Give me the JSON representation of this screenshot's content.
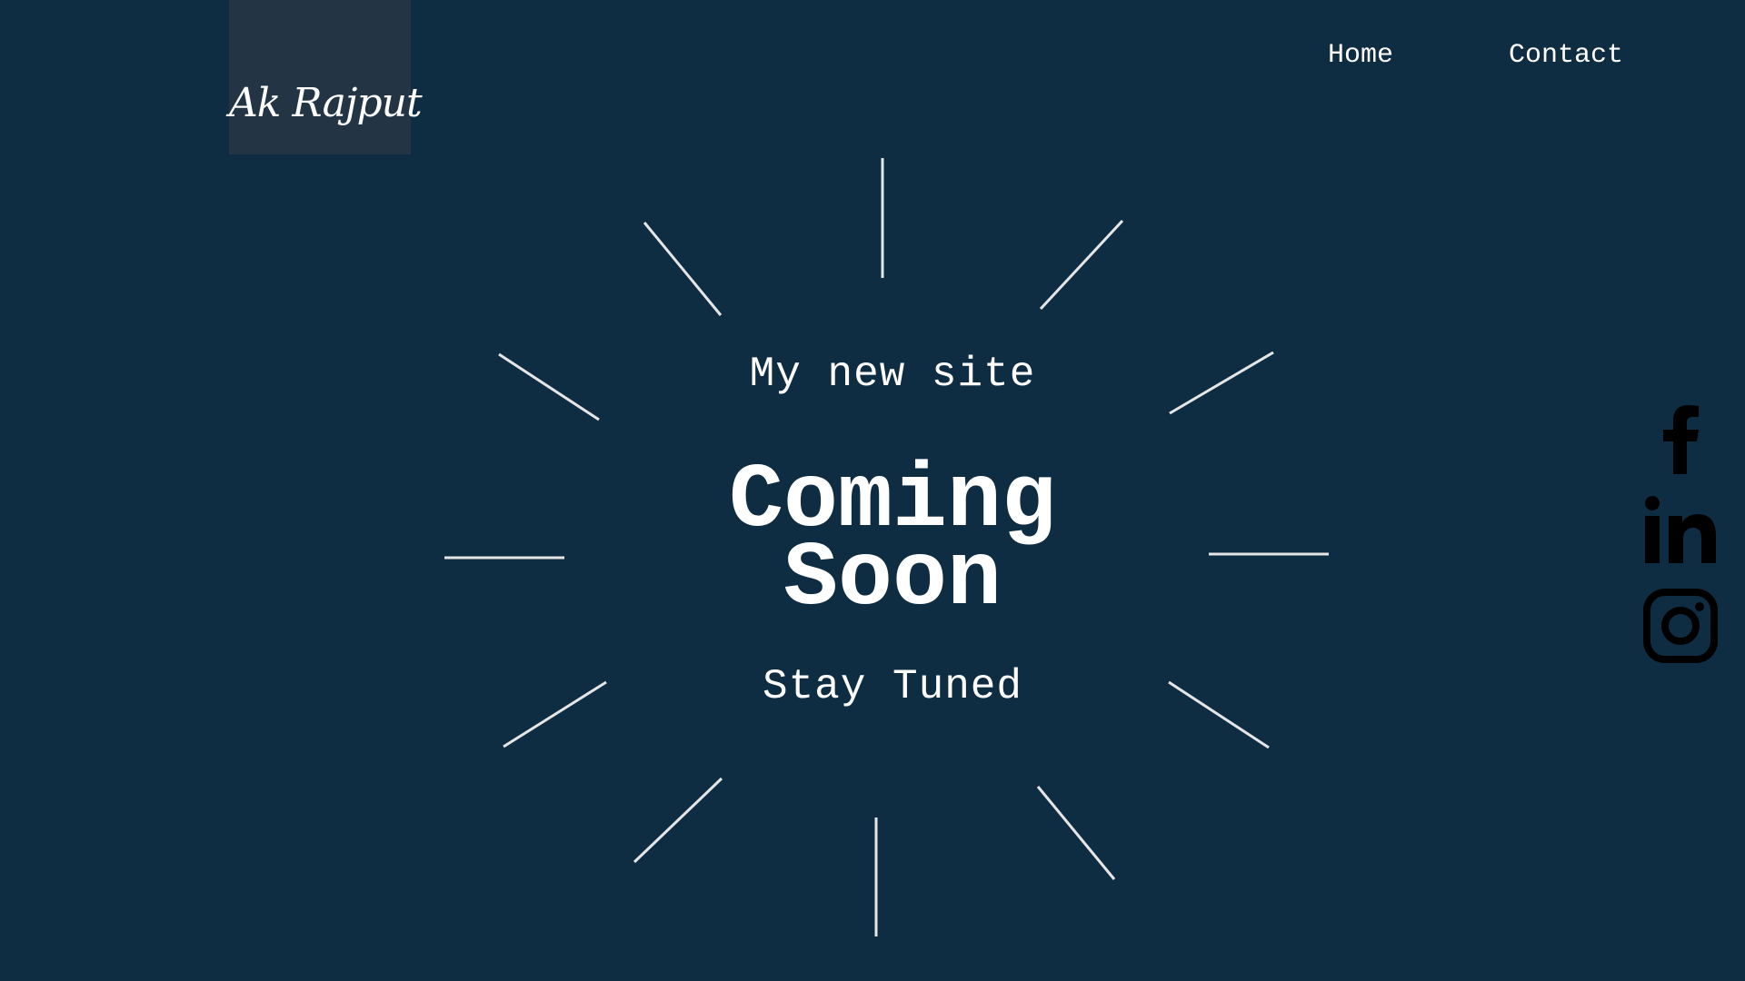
{
  "brand": {
    "logo_text": "Ak Rajput"
  },
  "nav": {
    "home": "Home",
    "contact": "Contact"
  },
  "hero": {
    "subtitle": "My new site",
    "headline_line1": "Coming",
    "headline_line2": "Soon",
    "tagline": "Stay Tuned"
  },
  "social": [
    {
      "name": "facebook",
      "icon": "facebook-icon"
    },
    {
      "name": "linkedin",
      "icon": "linkedin-icon"
    },
    {
      "name": "instagram",
      "icon": "instagram-icon"
    }
  ],
  "colors": {
    "background": "#0f2d42",
    "logo_box": "#233545",
    "text": "#ffffff",
    "burst_lines": "#e6e6e6",
    "social_icons": "#000000"
  }
}
